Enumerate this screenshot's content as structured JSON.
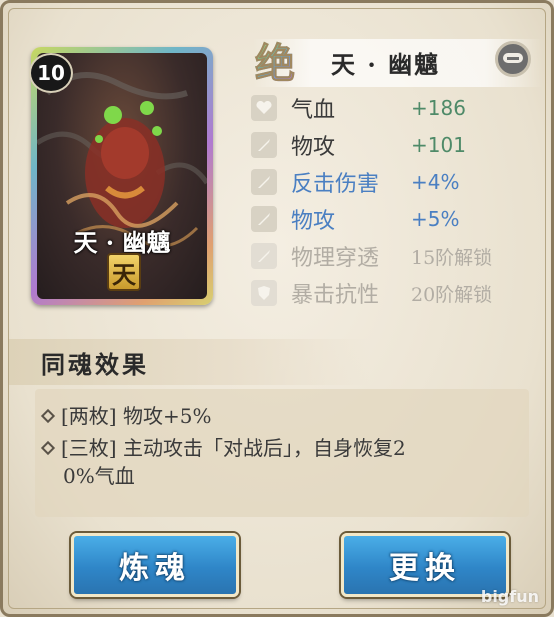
{
  "card": {
    "level": "10",
    "name": "天 · 幽魑",
    "rank": "天"
  },
  "soul": {
    "rarity_glyph": "绝",
    "name": "天 · 幽魑"
  },
  "stats": [
    {
      "label": "气血",
      "value": "+186",
      "icon": "heart-icon"
    },
    {
      "label": "物攻",
      "value": "+101",
      "icon": "sword-icon"
    },
    {
      "label": "反击伤害",
      "value": "+4%",
      "icon": "sword-icon"
    },
    {
      "label": "物攻",
      "value": "+5%",
      "icon": "sword-icon"
    },
    {
      "label": "物理穿透",
      "value": "15阶解锁",
      "icon": "sword-icon"
    },
    {
      "label": "暴击抗性",
      "value": "20阶解锁",
      "icon": "shield-icon"
    }
  ],
  "set_effect": {
    "title": "同魂效果",
    "lines": [
      "[两枚] 物攻+5%",
      "[三枚] 主动攻击「对战后」，自身恢复2",
      "0%气血"
    ]
  },
  "buttons": {
    "refine": "炼魂",
    "replace": "更换"
  },
  "watermark": "bigfun",
  "colors": {
    "stat_green": "#4e8a68",
    "stat_blue": "#4a7fc2",
    "locked_gray": "#b2ada4",
    "button_blue": "#2f86c8"
  }
}
